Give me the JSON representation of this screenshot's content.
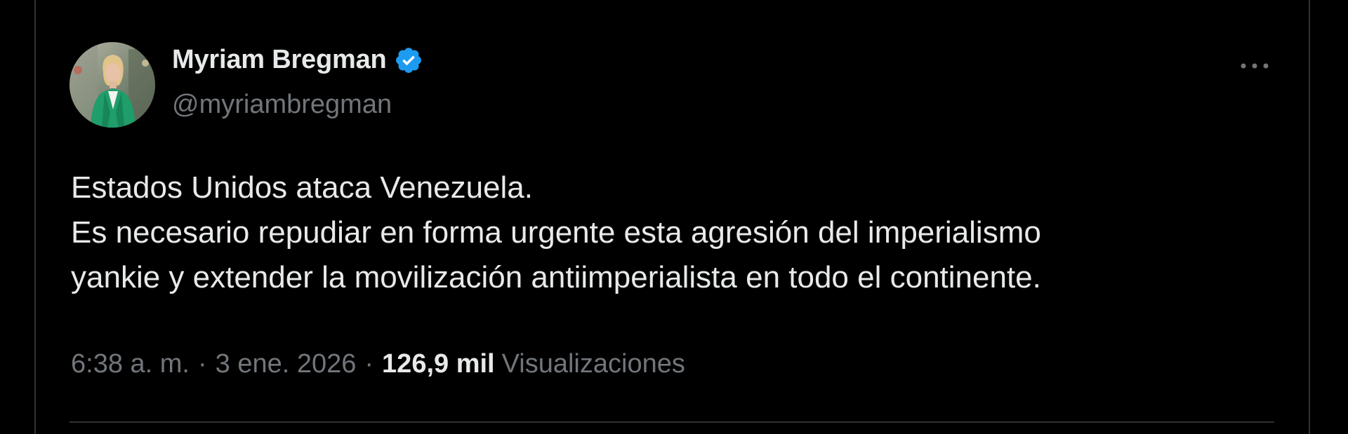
{
  "theme": {
    "background": "#000000",
    "text_primary": "#e7e9ea",
    "text_secondary": "#71767b",
    "border": "#2f3336",
    "verified_badge": "#1d9bf0"
  },
  "author": {
    "display_name": "Myriam Bregman",
    "handle": "@myriambregman",
    "verified_icon": "verified-badge-icon",
    "avatar_icon": "profile-photo"
  },
  "menu": {
    "icon": "more-options-icon"
  },
  "tweet": {
    "lines": [
      "Estados Unidos ataca Venezuela.",
      "Es necesario repudiar en forma urgente esta agresión del imperialismo",
      "yankie y extender la movilización antiimperialista en todo el continente."
    ]
  },
  "meta": {
    "time": "6:38 a. m.",
    "separator": "·",
    "date": "3 ene. 2026",
    "views_count": "126,9 mil",
    "views_label": "Visualizaciones"
  }
}
